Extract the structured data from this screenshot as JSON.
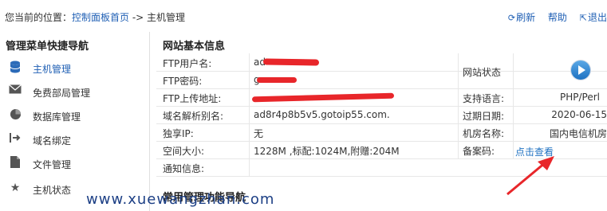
{
  "breadcrumb": {
    "prefix": "您当前的位置：",
    "home": "控制面板首页",
    "sep": " -> ",
    "current": "主机管理"
  },
  "top_actions": {
    "refresh": "刷新",
    "help": "帮助",
    "logout": "退出"
  },
  "sidebar": {
    "title": "管理菜单快捷导航",
    "items": [
      {
        "label": "主机管理",
        "icon": "database-icon",
        "active": true
      },
      {
        "label": "免费部局管理",
        "icon": "envelope-icon",
        "active": false
      },
      {
        "label": "数据库管理",
        "icon": "pie-chart-icon",
        "active": false
      },
      {
        "label": "域名绑定",
        "icon": "arrow-right-icon",
        "active": false
      },
      {
        "label": "文件管理",
        "icon": "file-icon",
        "active": false
      },
      {
        "label": "主机状态",
        "icon": "star-icon",
        "active": false
      }
    ]
  },
  "main": {
    "title": "网站基本信息",
    "rows": [
      {
        "label": "FTP用户名:",
        "value": "ad"
      },
      {
        "label": "FTP密码:",
        "value": "g"
      },
      {
        "label": "FTP上传地址:",
        "value": ""
      },
      {
        "label": "域名解析别名:",
        "value": "ad8r4p8b5v5.gotoip55.com."
      },
      {
        "label": "独享IP:",
        "value": "无"
      },
      {
        "label": "空间大小:",
        "value": "1228M ,标配:1024M,附赠:204M"
      },
      {
        "label": "通知信息:",
        "value": ""
      }
    ],
    "right_rows": [
      {
        "label": "网站状态",
        "value": ""
      },
      {
        "label": "支持语言:",
        "value": "PHP/Perl"
      },
      {
        "label": "过期日期:",
        "value": "2020-06-15"
      },
      {
        "label": "机房名称:",
        "value": "国内电信机房"
      },
      {
        "label": "备案码:",
        "value": "点击查看"
      }
    ],
    "second_title": "常用管理功能导航"
  },
  "watermark": "www.xuewangzhan.com",
  "colors": {
    "link": "#1f5fb4",
    "redaction": "#e8262a",
    "arrow": "#e8262a"
  }
}
